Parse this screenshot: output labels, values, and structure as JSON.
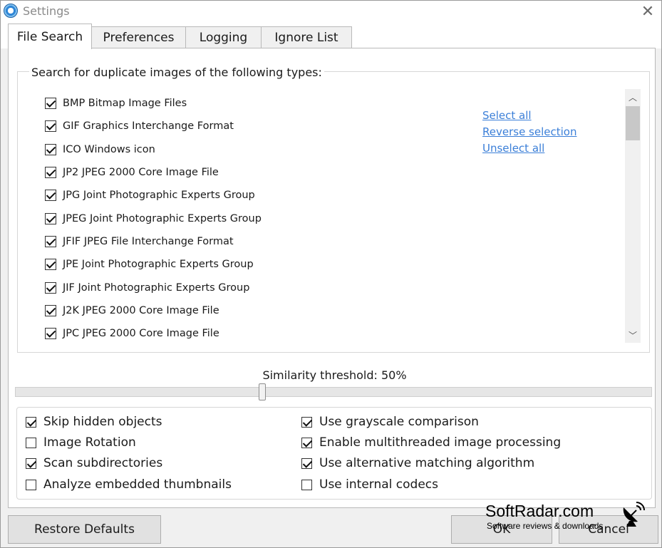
{
  "window": {
    "title": "Settings"
  },
  "tabs": [
    {
      "label": "File Search",
      "active": true
    },
    {
      "label": "Preferences",
      "active": false
    },
    {
      "label": "Logging",
      "active": false
    },
    {
      "label": "Ignore List",
      "active": false
    }
  ],
  "file_search": {
    "group_title": "Search for duplicate images of the following types:",
    "types": [
      {
        "label": "BMP  Bitmap Image Files",
        "checked": true
      },
      {
        "label": "GIF  Graphics Interchange Format",
        "checked": true
      },
      {
        "label": "ICO  Windows icon",
        "checked": true
      },
      {
        "label": "JP2  JPEG 2000 Core Image File",
        "checked": true
      },
      {
        "label": "JPG  Joint Photographic Experts Group",
        "checked": true
      },
      {
        "label": "JPEG  Joint Photographic Experts Group",
        "checked": true
      },
      {
        "label": "JFIF  JPEG File Interchange Format",
        "checked": true
      },
      {
        "label": "JPE  Joint Photographic Experts Group",
        "checked": true
      },
      {
        "label": "JIF  Joint Photographic Experts Group",
        "checked": true
      },
      {
        "label": "J2K  JPEG 2000 Core Image File",
        "checked": true
      },
      {
        "label": "JPC  JPEG 2000 Core Image File",
        "checked": true
      }
    ],
    "links": {
      "select_all": "Select all",
      "reverse_selection": "Reverse selection",
      "unselect_all": "Unselect all"
    },
    "similarity_label": "Similarity threshold: 50%",
    "similarity_value": 0.5,
    "options": [
      {
        "label": "Skip hidden objects",
        "checked": true
      },
      {
        "label": "Image Rotation",
        "checked": false
      },
      {
        "label": "Scan subdirectories",
        "checked": true
      },
      {
        "label": "Analyze embedded thumbnails",
        "checked": false
      },
      {
        "label": "Use grayscale comparison",
        "checked": true
      },
      {
        "label": "Enable multithreaded image processing",
        "checked": true
      },
      {
        "label": "Use alternative matching algorithm",
        "checked": true
      },
      {
        "label": "Use internal codecs",
        "checked": false
      }
    ]
  },
  "buttons": {
    "restore_defaults": "Restore Defaults",
    "ok": "OK",
    "cancel": "Cancel"
  },
  "watermark": {
    "name": "SoftRadar.com",
    "tagline": "Software reviews & downloads"
  }
}
